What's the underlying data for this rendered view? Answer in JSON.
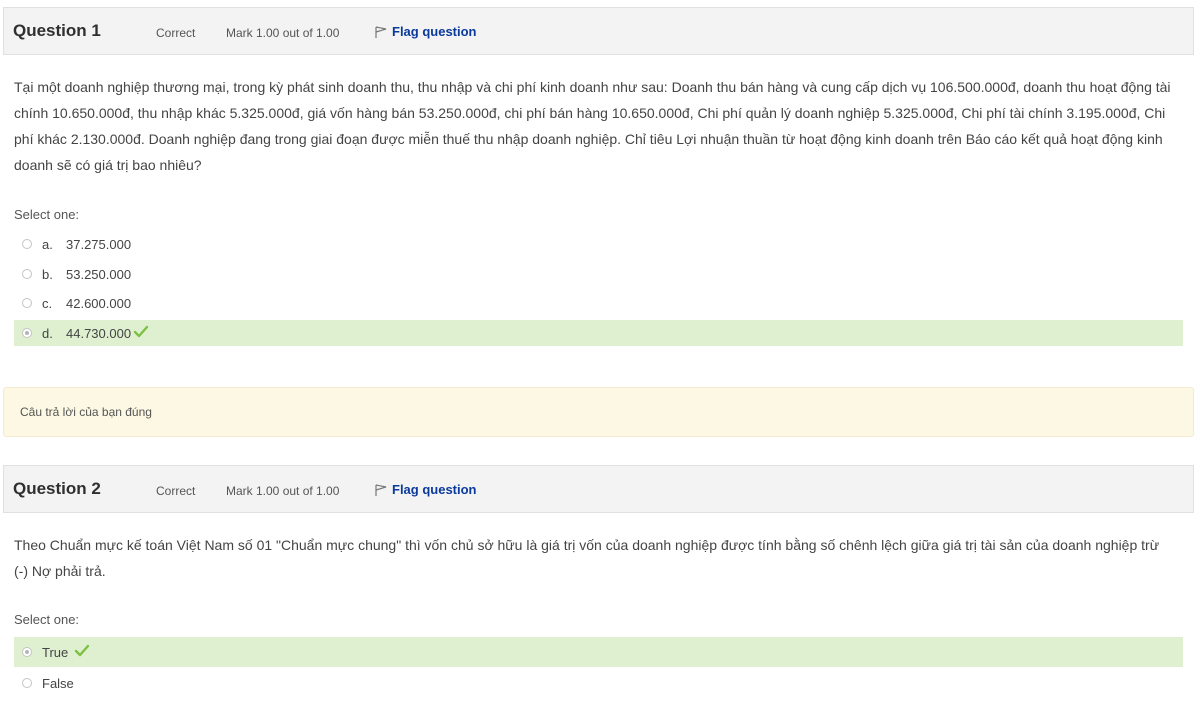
{
  "q1": {
    "title": "Question 1",
    "state": "Correct",
    "mark": "Mark 1.00 out of 1.00",
    "flag_label": "Flag question",
    "text": "Tại một doanh nghiệp thương mại, trong kỳ phát sinh doanh thu, thu nhập và chi phí kinh doanh như sau: Doanh thu bán hàng và cung cấp dịch vụ 106.500.000đ, doanh thu hoạt động tài chính 10.650.000đ, thu nhập khác 5.325.000đ, giá vốn hàng bán 53.250.000đ, chi phí bán hàng 10.650.000đ, Chi phí quản lý doanh nghiệp 5.325.000đ, Chi phí tài chính 3.195.000đ, Chi phí khác 2.130.000đ. Doanh nghiệp đang trong giai đoạn được miễn thuế thu nhập doanh nghiệp. Chỉ tiêu Lợi nhuận thuần từ hoạt động kinh doanh trên Báo cáo kết quả hoạt động kinh doanh sẽ có giá trị bao nhiêu?",
    "select_label": "Select one:",
    "options": [
      {
        "letter": "a.",
        "text": "37.275.000"
      },
      {
        "letter": "b.",
        "text": "53.250.000"
      },
      {
        "letter": "c.",
        "text": "42.600.000"
      },
      {
        "letter": "d.",
        "text": "44.730.000"
      }
    ],
    "feedback": "Câu trả lời của bạn đúng"
  },
  "q2": {
    "title": "Question 2",
    "state": "Correct",
    "mark": "Mark 1.00 out of 1.00",
    "flag_label": "Flag question",
    "text": "Theo Chuẩn mực kế toán Việt Nam số 01 \"Chuẩn mực chung\" thì vốn chủ sở hữu là giá trị vốn của doanh nghiệp được tính bằng số chênh lệch giữa giá trị tài sản của doanh nghiệp trừ (-) Nợ phải trả.",
    "select_label": "Select one:",
    "options": [
      {
        "text": "True"
      },
      {
        "text": "False"
      }
    ]
  },
  "colors": {
    "correct_bg": "#dff0d0",
    "check": "#7cc142",
    "flag_link": "#0a3a9c",
    "feedback_bg": "#fcf8e3"
  }
}
